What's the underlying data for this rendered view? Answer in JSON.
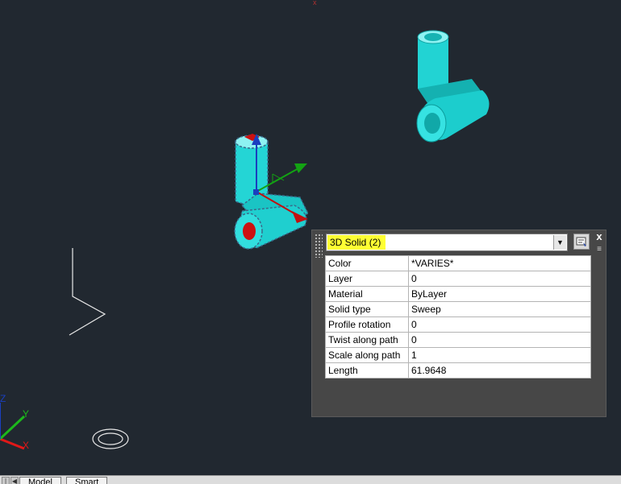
{
  "quick_properties": {
    "object_type": "3D Solid (2)",
    "rows": [
      {
        "label": "Color",
        "value": "*VARIES*"
      },
      {
        "label": "Layer",
        "value": "0"
      },
      {
        "label": "Material",
        "value": "ByLayer"
      },
      {
        "label": "Solid type",
        "value": "Sweep"
      },
      {
        "label": "Profile rotation",
        "value": "0"
      },
      {
        "label": "Twist along path",
        "value": "0"
      },
      {
        "label": "Scale along path",
        "value": "1"
      },
      {
        "label": "Length",
        "value": "61.9648"
      }
    ],
    "close_glyph": "x",
    "menu_glyph": "≡"
  },
  "ucs": {
    "x_label": "X",
    "y_label": "Y",
    "z_label": "Z"
  },
  "tabs": {
    "model": "Model",
    "second": "Smart"
  },
  "colors": {
    "background": "#212830",
    "solid": "#1fd8d8",
    "selection_highlight": "#ffff33",
    "grip_red": "#cc1111"
  }
}
